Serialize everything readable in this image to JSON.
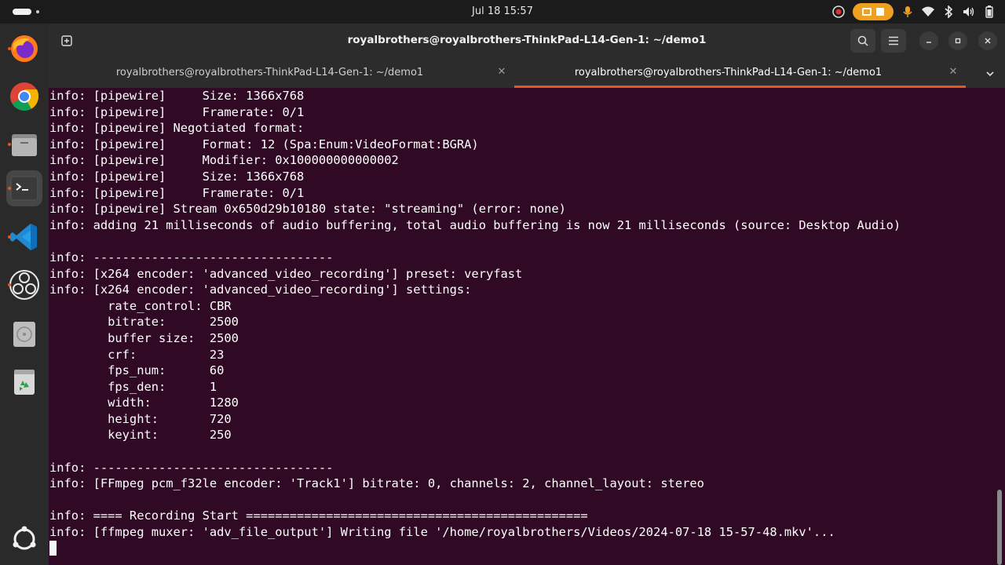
{
  "topbar": {
    "clock": "Jul 18  15:57",
    "icons": [
      "activities-icon",
      "screen-recording-indicator",
      "microphone-icon",
      "wifi-icon",
      "bluetooth-icon",
      "volume-icon",
      "battery-icon"
    ]
  },
  "dock": {
    "apps": [
      "firefox-icon",
      "chrome-icon",
      "files-icon",
      "terminal-icon",
      "vscode-icon",
      "obs-icon",
      "disk-icon",
      "trash-icon",
      "ubuntu-apps-icon"
    ]
  },
  "window": {
    "title": "royalbrothers@royalbrothers-ThinkPad-L14-Gen-1: ~/demo1",
    "tabs": [
      {
        "label": "royalbrothers@royalbrothers-ThinkPad-L14-Gen-1: ~/demo1"
      },
      {
        "label": "royalbrothers@royalbrothers-ThinkPad-L14-Gen-1: ~/demo1"
      }
    ]
  },
  "colors": {
    "terminal_bg": "#300a24",
    "accent": "#e95420",
    "recording": "#f0a020"
  },
  "terminal": {
    "lines": [
      "info: [pipewire]     Size: 1366x768",
      "info: [pipewire]     Framerate: 0/1",
      "info: [pipewire] Negotiated format:",
      "info: [pipewire]     Format: 12 (Spa:Enum:VideoFormat:BGRA)",
      "info: [pipewire]     Modifier: 0x100000000000002",
      "info: [pipewire]     Size: 1366x768",
      "info: [pipewire]     Framerate: 0/1",
      "info: [pipewire] Stream 0x650d29b10180 state: \"streaming\" (error: none)",
      "info: adding 21 milliseconds of audio buffering, total audio buffering is now 21 milliseconds (source: Desktop Audio)",
      "",
      "info: ---------------------------------",
      "info: [x264 encoder: 'advanced_video_recording'] preset: veryfast",
      "info: [x264 encoder: 'advanced_video_recording'] settings:",
      "        rate_control: CBR",
      "        bitrate:      2500",
      "        buffer size:  2500",
      "        crf:          23",
      "        fps_num:      60",
      "        fps_den:      1",
      "        width:        1280",
      "        height:       720",
      "        keyint:       250",
      "",
      "info: ---------------------------------",
      "info: [FFmpeg pcm_f32le encoder: 'Track1'] bitrate: 0, channels: 2, channel_layout: stereo",
      "",
      "info: ==== Recording Start ===============================================",
      "info: [ffmpeg muxer: 'adv_file_output'] Writing file '/home/royalbrothers/Videos/2024-07-18 15-57-48.mkv'..."
    ]
  }
}
